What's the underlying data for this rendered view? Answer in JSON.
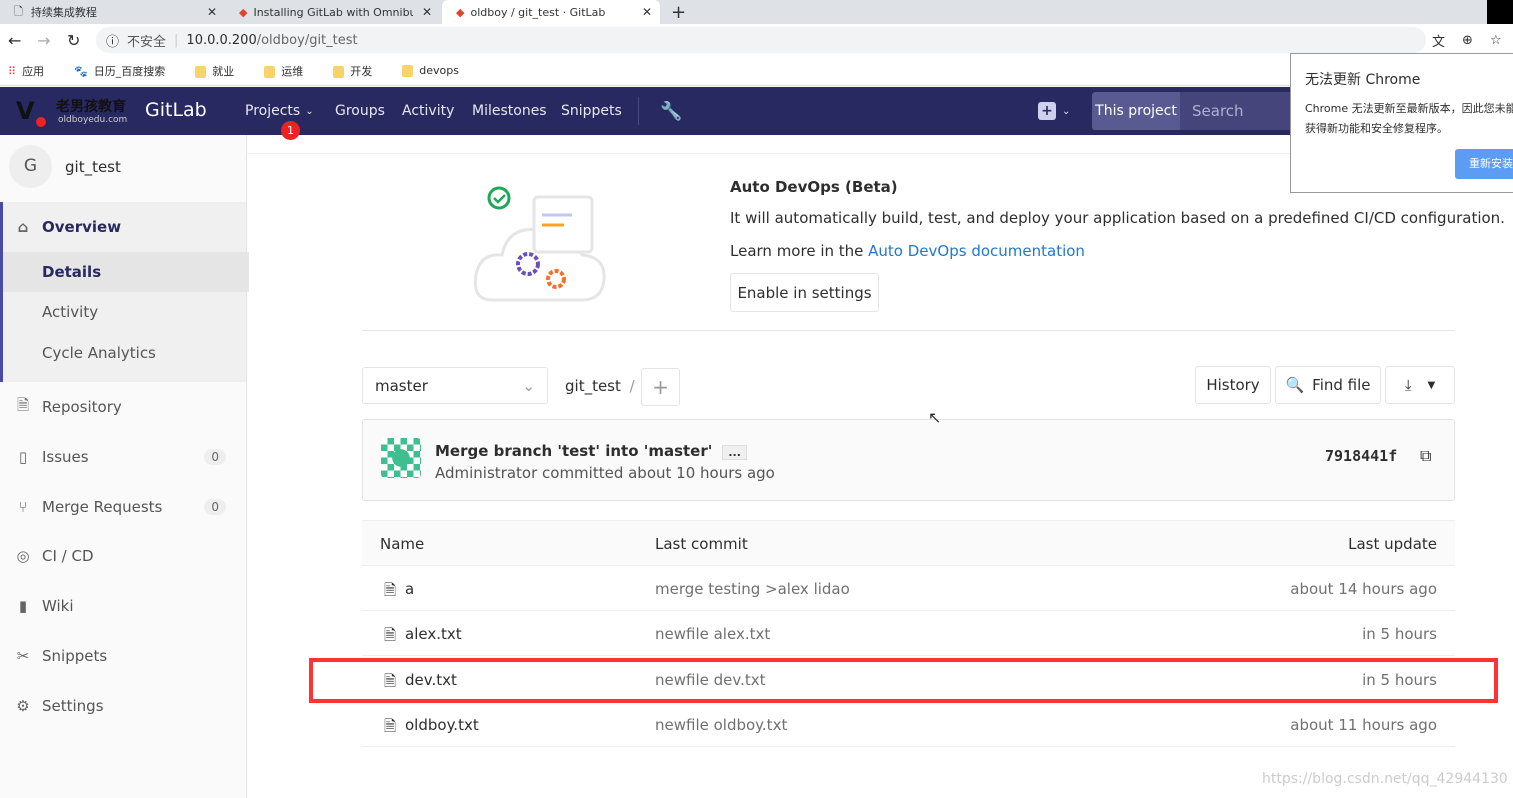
{
  "browser": {
    "tabs": [
      {
        "label": "持续集成教程",
        "active": false
      },
      {
        "label": "Installing GitLab with Omnibus",
        "active": false
      },
      {
        "label": "oldboy / git_test · GitLab",
        "active": true
      }
    ],
    "new_tab": "+",
    "security": "不安全",
    "url_host": "10.0.0.200",
    "url_path": "/oldboy/git_test",
    "bookmarks": [
      "应用",
      "日历_百度搜索",
      "就业",
      "运维",
      "开发",
      "devops"
    ]
  },
  "update_popup": {
    "title": "无法更新 Chrome",
    "body": "Chrome 无法更新至最新版本，因此您未能获得新功能和安全修复程序。",
    "button": "重新安装"
  },
  "header": {
    "logo_text": "老男孩教育",
    "logo_sub": "oldboyedu.com",
    "brand": "GitLab",
    "nav": [
      "Projects",
      "Groups",
      "Activity",
      "Milestones",
      "Snippets"
    ],
    "projects_badge": "1",
    "search_scope": "This project",
    "search_placeholder": "Search",
    "color": "#292961"
  },
  "sidebar": {
    "avatar": "G",
    "project": "git_test",
    "items": [
      {
        "label": "Overview",
        "icon": "home-icon"
      },
      {
        "label": "Details"
      },
      {
        "label": "Activity"
      },
      {
        "label": "Cycle Analytics"
      },
      {
        "label": "Repository",
        "icon": "doc-icon"
      },
      {
        "label": "Issues",
        "icon": "issues-icon",
        "count": "0"
      },
      {
        "label": "Merge Requests",
        "icon": "merge-icon",
        "count": "0"
      },
      {
        "label": "CI / CD",
        "icon": "rocket-icon"
      },
      {
        "label": "Wiki",
        "icon": "book-icon"
      },
      {
        "label": "Snippets",
        "icon": "scissors-icon"
      },
      {
        "label": "Settings",
        "icon": "gear-icon"
      }
    ]
  },
  "devops": {
    "title": "Auto DevOps (Beta)",
    "desc": "It will automatically build, test, and deploy your application based on a predefined CI/CD configuration.",
    "learn_prefix": "Learn more in the ",
    "learn_link": "Auto DevOps documentation",
    "enable": "Enable in settings"
  },
  "repo": {
    "branch": "master",
    "path": "git_test",
    "sep": "/",
    "add": "+",
    "history": "History",
    "find": "Find file"
  },
  "commit": {
    "title": "Merge branch 'test' into 'master'",
    "ellipsis": "...",
    "meta": "Administrator committed about 10 hours ago",
    "sha": "7918441f"
  },
  "files": {
    "headers": [
      "Name",
      "Last commit",
      "Last update"
    ],
    "rows": [
      {
        "name": "a",
        "commit": "merge testing >alex lidao",
        "update": "about 14 hours ago"
      },
      {
        "name": "alex.txt",
        "commit": "newfile alex.txt",
        "update": "in 5 hours"
      },
      {
        "name": "dev.txt",
        "commit": "newfile dev.txt",
        "update": "in 5 hours",
        "highlighted": true
      },
      {
        "name": "oldboy.txt",
        "commit": "newfile oldboy.txt",
        "update": "about 11 hours ago"
      }
    ]
  },
  "watermark": "https://blog.csdn.net/qq_42944130",
  "colors": {
    "link": "#1f78d1",
    "highlight": "#ff3333"
  }
}
